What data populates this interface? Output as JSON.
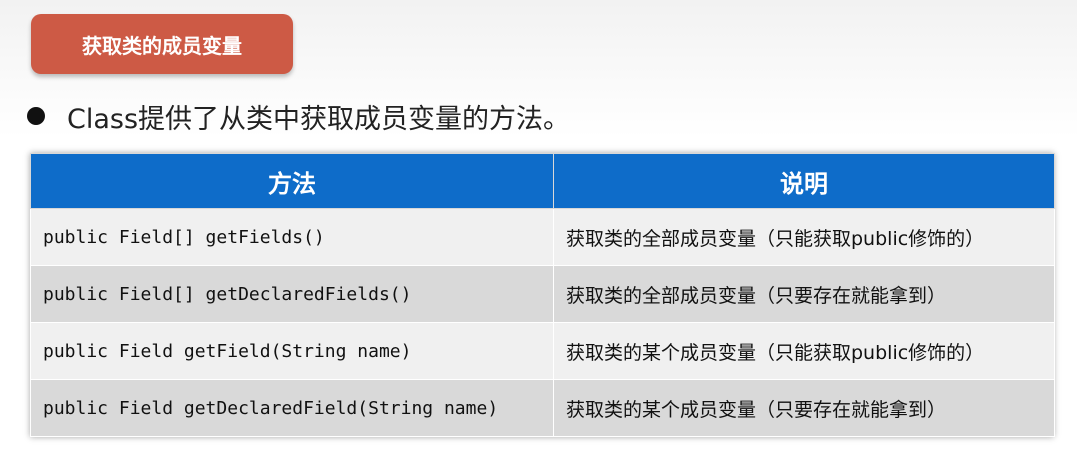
{
  "badge": {
    "title": "获取类的成员变量"
  },
  "bullet": {
    "text": "Class提供了从类中获取成员变量的方法。"
  },
  "table": {
    "headers": [
      "方法",
      "说明"
    ],
    "rows": [
      {
        "method": "public Field[] getFields()",
        "desc": "获取类的全部成员变量（只能获取public修饰的）"
      },
      {
        "method": "public Field[] getDeclaredFields()",
        "desc": "获取类的全部成员变量（只要存在就能拿到）"
      },
      {
        "method": "public Field getField(String name)",
        "desc": "获取类的某个成员变量（只能获取public修饰的）"
      },
      {
        "method": "public Field getDeclaredField(String name)",
        "desc": "获取类的某个成员变量（只要存在就能拿到）"
      }
    ]
  }
}
